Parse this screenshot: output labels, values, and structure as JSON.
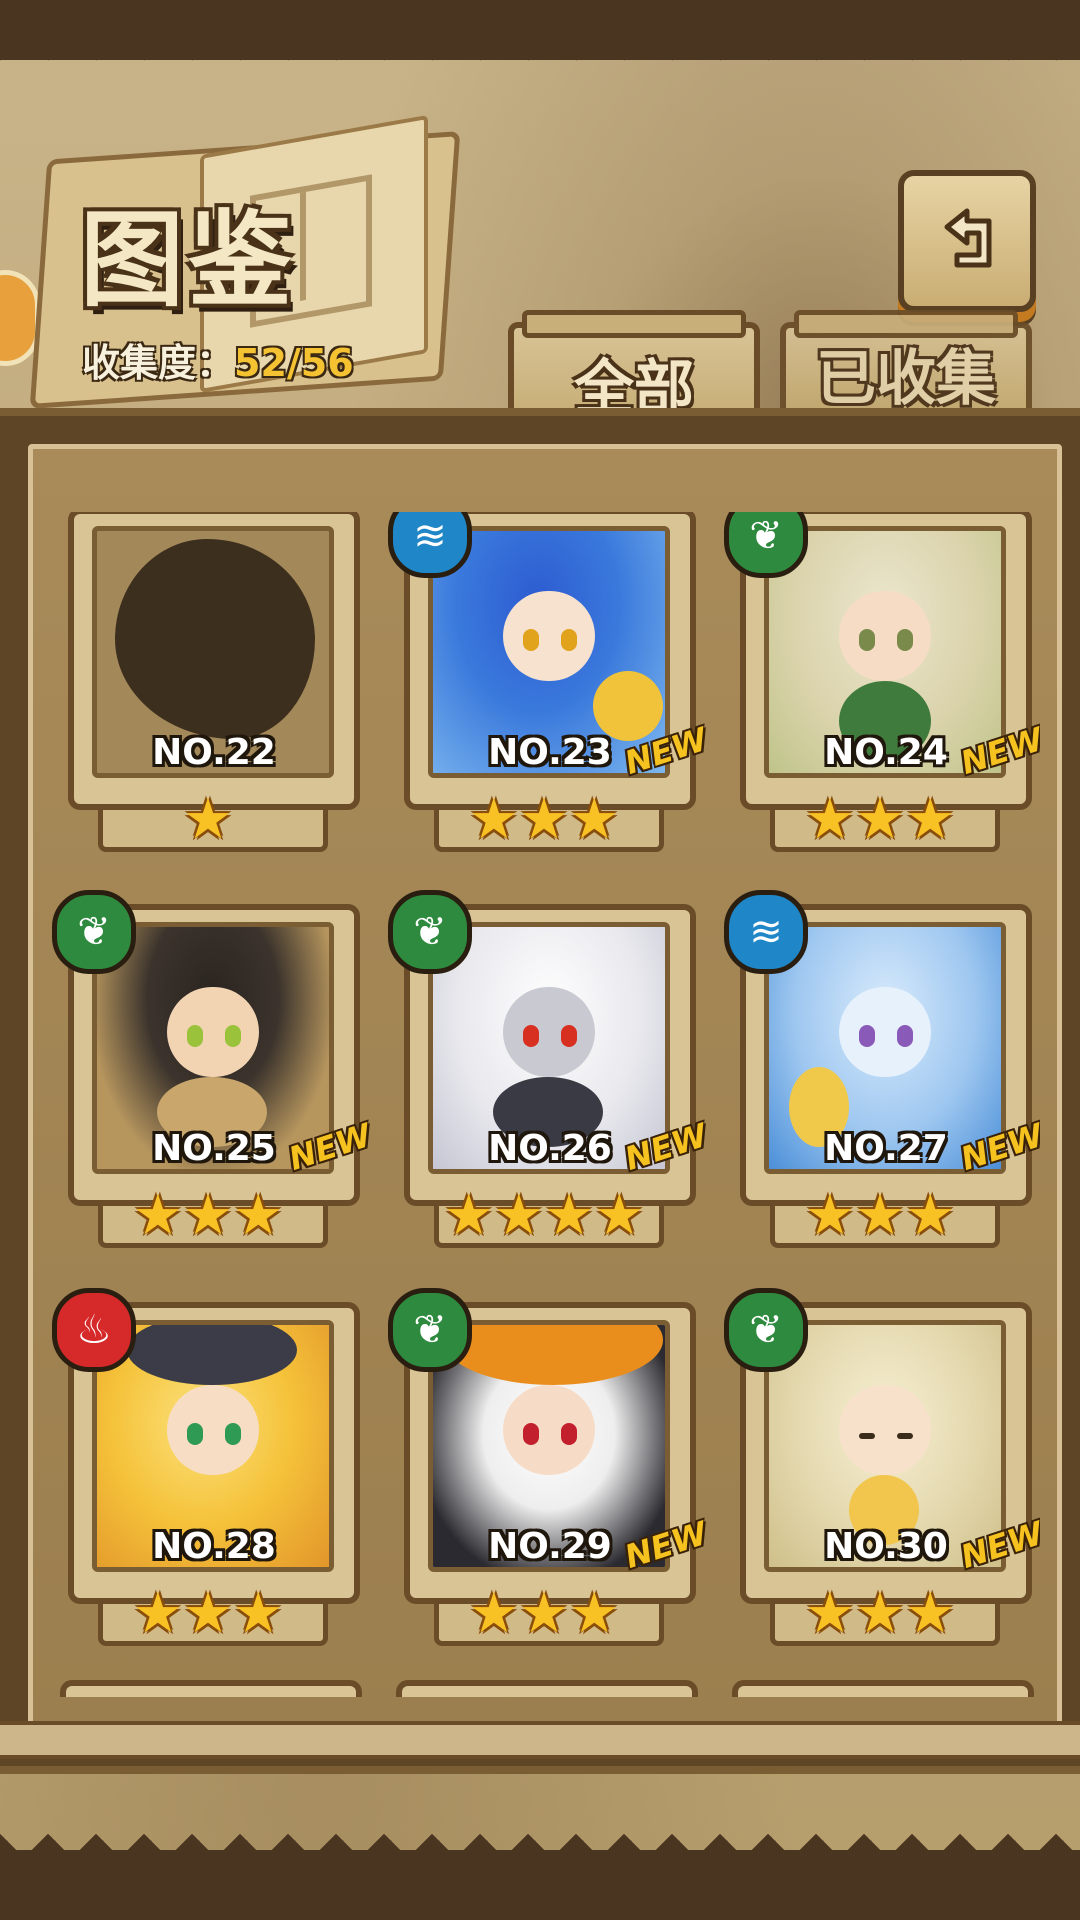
{
  "header": {
    "title": "图鉴",
    "collection_label": "收集度：",
    "collection_value": "52/56"
  },
  "tabs": [
    {
      "label": "全部",
      "active": true
    },
    {
      "label": "已收集",
      "active": false
    }
  ],
  "colors": {
    "water": "#1f86c7",
    "wood": "#2e8a3e",
    "fire": "#d62a2a",
    "star": "#f8c224",
    "new": "#f6c21f"
  },
  "cards": [
    {
      "number": "NO.22",
      "stars": "★",
      "element": "none",
      "new": "",
      "silhouette": true
    },
    {
      "number": "NO.23",
      "stars": "★★★",
      "element": "water-icon",
      "new": "NEW"
    },
    {
      "number": "NO.24",
      "stars": "★★★",
      "element": "leaf-icon",
      "new": "NEW"
    },
    {
      "number": "NO.25",
      "stars": "★★★",
      "element": "leaf-icon",
      "new": "NEW"
    },
    {
      "number": "NO.26",
      "stars": "★★★★",
      "element": "leaf-icon",
      "new": "NEW"
    },
    {
      "number": "NO.27",
      "stars": "★★★",
      "element": "water-icon",
      "new": "NEW"
    },
    {
      "number": "NO.28",
      "stars": "★★★",
      "element": "flame-icon",
      "new": ""
    },
    {
      "number": "NO.29",
      "stars": "★★★",
      "element": "leaf-icon",
      "new": "NEW"
    },
    {
      "number": "NO.30",
      "stars": "★★★",
      "element": "leaf-icon",
      "new": "NEW"
    }
  ]
}
